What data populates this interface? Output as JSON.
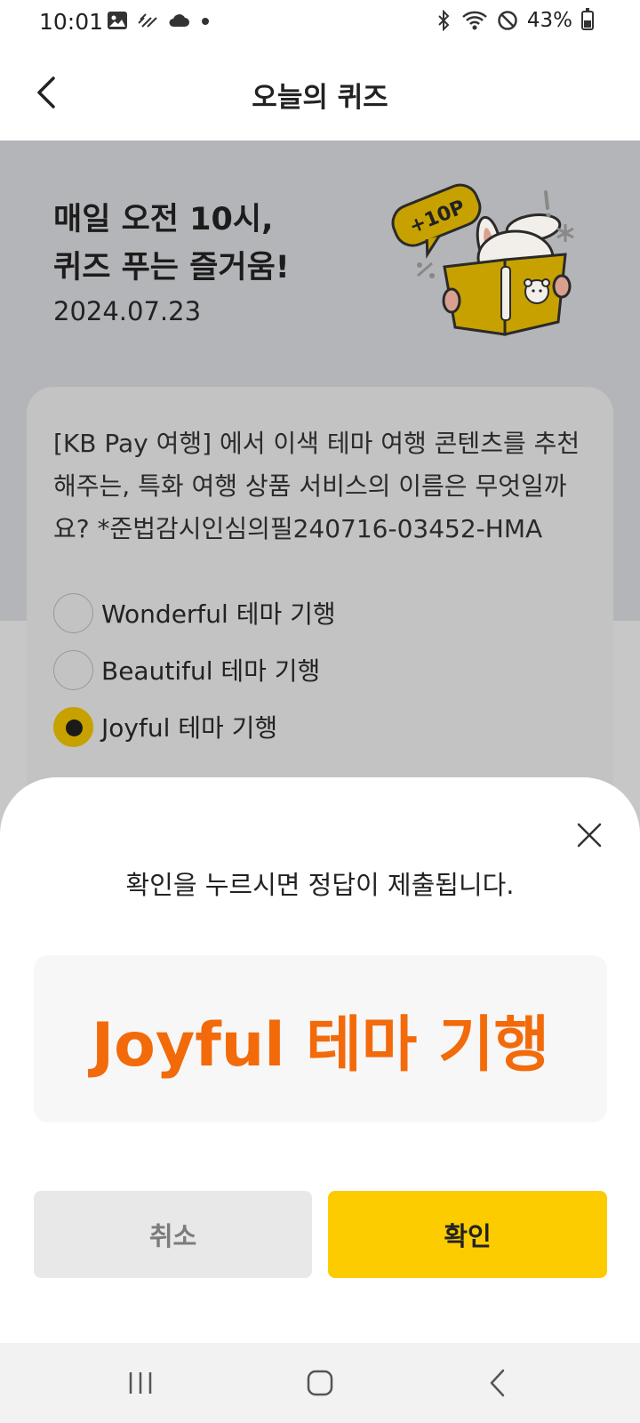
{
  "status_bar": {
    "time": "10:01",
    "battery": "43%",
    "battery_level": 0.43,
    "left_icons": [
      "gallery-icon",
      "pattern-icon",
      "cloud-icon",
      "dot-icon"
    ],
    "right_icons": [
      "bluetooth-icon",
      "wifi-icon",
      "do-not-disturb-icon"
    ]
  },
  "header": {
    "title": "오늘의 퀴즈",
    "back_icon": "chevron-left-icon"
  },
  "hero": {
    "title_line1": "매일 오전 10시,",
    "title_line2": "퀴즈 푸는 즐거움!",
    "date": "2024.07.23",
    "badge": "+10P"
  },
  "quiz": {
    "question": "[KB Pay 여행] 에서 이색 테마 여행 콘텐츠를 추천해주는, 특화 여행 상품 서비스의 이름은 무엇일까요? *준법감시인심의필240716-03452-HMA",
    "options": [
      {
        "label": "Wonderful 테마 기행",
        "selected": false
      },
      {
        "label": "Beautiful 테마 기행",
        "selected": false
      },
      {
        "label": "Joyful 테마 기행",
        "selected": true
      }
    ]
  },
  "sheet": {
    "message": "확인을 누르시면 정답이 제출됩니다.",
    "answer": "Joyful 테마 기행",
    "cancel_label": "취소",
    "confirm_label": "확인",
    "close_icon": "close-icon"
  },
  "nav": {
    "icons": [
      "recent-apps-icon",
      "home-icon",
      "back-icon"
    ]
  },
  "colors": {
    "accent_yellow": "#fccb00",
    "answer_orange": "#f26a0a",
    "dim_background": "#b4b5b8"
  }
}
